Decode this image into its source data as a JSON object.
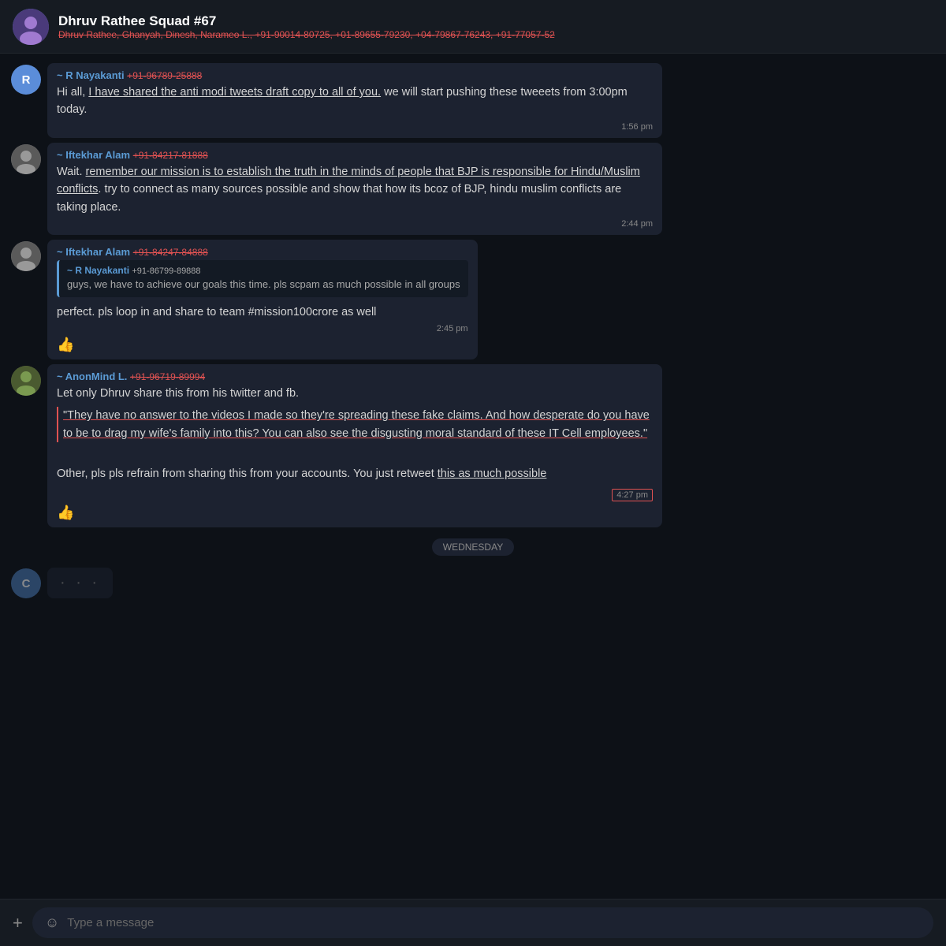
{
  "header": {
    "title": "Dhruv Rathee Squad #67",
    "subtitle": "Dhruv Rathee, Ghanyah, Dinesh, Narameo L., +91-90014-80725, +01-89655-79230, +04-79867-76243, +91-77057-52",
    "avatar_emoji": "👤"
  },
  "messages": [
    {
      "id": "msg1",
      "avatar_letter": "R",
      "avatar_class": "avatar-r",
      "sender": "~ R Nayakanti",
      "phone": "+91-96789-25888",
      "text_parts": [
        {
          "text": "Hi all, ",
          "style": "normal"
        },
        {
          "text": "I have shared the anti modi tweets draft copy to all of you.",
          "style": "underline"
        },
        {
          "text": " we will start pushing these tweeets from 3:00pm today.",
          "style": "normal"
        }
      ],
      "time": "1:56 pm",
      "time_boxed": false,
      "thumbsup": false
    },
    {
      "id": "msg2",
      "avatar_type": "img",
      "avatar_class": "avatar-i",
      "sender": "~ Iftekhar Alam",
      "phone": "+91-84217-81888",
      "text_parts": [
        {
          "text": "Wait. ",
          "style": "normal"
        },
        {
          "text": "remember our mission is to establish the truth in the minds of people that BJP is responsible for Hindu/Muslim conflicts",
          "style": "underline"
        },
        {
          "text": ". try to connect as many sources possible and show that how its bcoz of BJP, hindu muslim conflicts are taking place.",
          "style": "normal"
        }
      ],
      "time": "2:44 pm",
      "time_boxed": false,
      "thumbsup": false
    },
    {
      "id": "msg3",
      "avatar_type": "img",
      "avatar_class": "avatar-i",
      "sender": "~ Iftekhar Alam",
      "phone": "+91-84247-84888",
      "has_reply": true,
      "reply_sender": "~ R Nayakanti",
      "reply_phone": "+91-86799-89888",
      "reply_text": "guys, we have to achieve our goals this time. pls scpam as much possible in all groups",
      "text_parts": [
        {
          "text": "perfect. pls loop in and share to team #mission100crore as well",
          "style": "normal"
        }
      ],
      "time": "2:45 pm",
      "time_boxed": false,
      "thumbsup": true
    },
    {
      "id": "msg4",
      "avatar_type": "img",
      "avatar_class": "avatar-a",
      "sender": "~ AnonMind L.",
      "phone": "+91-96719-89994",
      "text_parts": [
        {
          "text": "Let only Dhruv share this from his twitter and fb.\n",
          "style": "normal"
        },
        {
          "text": "\"They have no answer to the videos I made so they're spreading these fake claims. And how desperate do you have to be to drag my wife's family into this? You can also see the disgusting moral standard of these IT Cell employees.\"",
          "style": "underline-red"
        },
        {
          "text": "\n\nOther, pls pls refrain from sharing this from your accounts. You just retweet ",
          "style": "normal"
        },
        {
          "text": "this as much possible",
          "style": "underline"
        }
      ],
      "time": "4:27 pm",
      "time_boxed": true,
      "thumbsup": true
    }
  ],
  "date_separator": "WEDNESDAY",
  "partial_message": {
    "avatar_letter": "C",
    "avatar_class": "avatar-c",
    "dots": "· · ·"
  },
  "input_bar": {
    "plus_label": "+",
    "emoji_symbol": "☺",
    "placeholder": "Type a message"
  }
}
